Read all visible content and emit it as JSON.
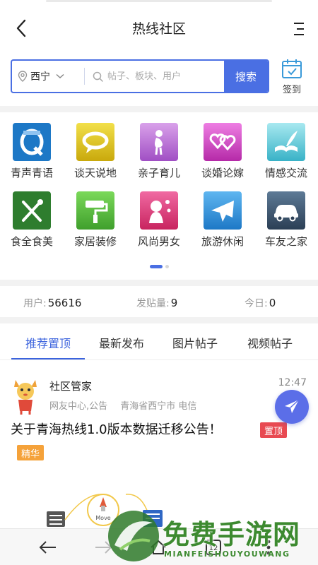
{
  "header": {
    "title": "热线社区"
  },
  "search": {
    "region": "西宁",
    "placeholder": "帖子、板块、用户",
    "button_label": "搜索"
  },
  "checkin": {
    "label": "签到"
  },
  "categories": [
    {
      "label": "青声青语",
      "icon": "speech-q-icon",
      "color": "#1d78c6"
    },
    {
      "label": "谈天说地",
      "icon": "chat-bubble-icon",
      "color": "#d7c21b"
    },
    {
      "label": "亲子育儿",
      "icon": "mother-icon",
      "color": "#b66ad1"
    },
    {
      "label": "谈婚论嫁",
      "icon": "hearts-icon",
      "color": "#d245c8"
    },
    {
      "label": "情感交流",
      "icon": "book-feather-icon",
      "color": "#38b8c8"
    },
    {
      "label": "食全食美",
      "icon": "cutlery-icon",
      "color": "#2e8b2e"
    },
    {
      "label": "家居装修",
      "icon": "paint-roller-icon",
      "color": "#5bbf3c"
    },
    {
      "label": "风尚男女",
      "icon": "fashion-icon",
      "color": "#d93b7c"
    },
    {
      "label": "旅游休闲",
      "icon": "airplane-icon",
      "color": "#2a8fd9"
    },
    {
      "label": "车友之家",
      "icon": "car-icon",
      "color": "#3c5a78"
    }
  ],
  "pager": {
    "pages": 2,
    "active": 1
  },
  "stats": {
    "users_label": "用户:",
    "users_value": "56616",
    "posts_label": "发贴量:",
    "posts_value": "9",
    "today_label": "今日:",
    "today_value": "0"
  },
  "tabs": [
    {
      "label": "推荐置顶",
      "active": true
    },
    {
      "label": "最新发布",
      "active": false
    },
    {
      "label": "图片帖子",
      "active": false
    },
    {
      "label": "视频帖子",
      "active": false
    }
  ],
  "post": {
    "author": "社区管家",
    "time": "12:47",
    "meta_source": "网友中心,公告",
    "meta_location": "青海省西宁市 电信",
    "title": "关于青海热线1.0版本数据迁移公告！",
    "badge_top": "置顶",
    "badge_essence": "精华",
    "image_caption": "Move"
  },
  "bottom_nav": {
    "tab_count": "12"
  },
  "watermark": {
    "text": "免费手游网",
    "sub": "MIANFEISHOUYOUWANG"
  },
  "colors": {
    "accent": "#4a6fe3",
    "tab_active": "#3b63dd",
    "badge_top": "#e84a52",
    "badge_essence": "#f5a23a"
  }
}
